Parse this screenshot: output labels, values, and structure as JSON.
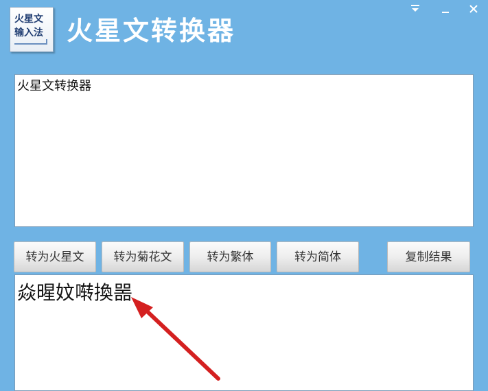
{
  "app": {
    "logo_line1": "火星文",
    "logo_line2": "输入法",
    "title": "火星文转换器"
  },
  "input": {
    "value": "火星文转换器"
  },
  "buttons": {
    "to_martian": "转为火星文",
    "to_chrysanthemum": "转为菊花文",
    "to_traditional": "转为繁体",
    "to_simplified": "转为简体",
    "copy_result": "复制结果"
  },
  "output": {
    "value": "焱暒妏啭換噐"
  },
  "colors": {
    "background": "#6fb3e4",
    "arrow": "#d42020"
  }
}
